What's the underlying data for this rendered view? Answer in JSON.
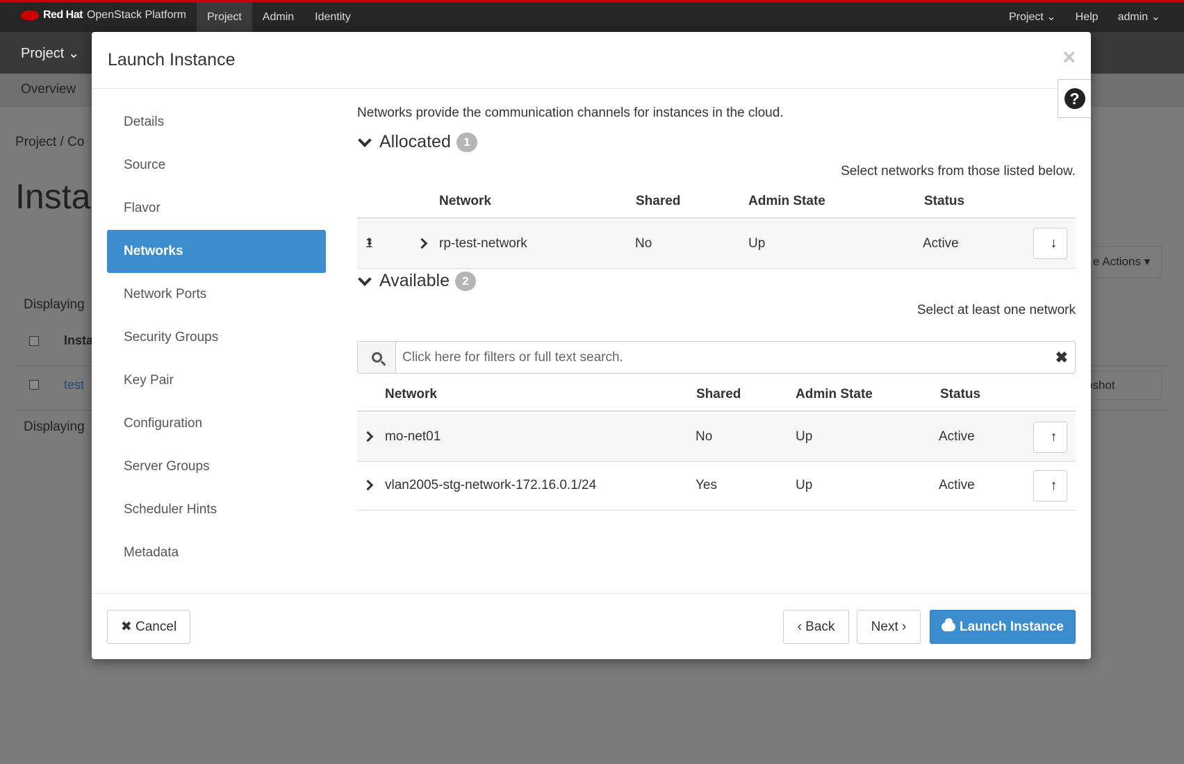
{
  "topbar": {
    "brand_bold": "Red Hat",
    "brand_rest": "OpenStack Platform",
    "nav": [
      "Project",
      "Admin",
      "Identity"
    ],
    "right": [
      "Project ⌄",
      "Help",
      "admin ⌄"
    ]
  },
  "background": {
    "project_menu": "Project ⌄",
    "overview_tab": "Overview",
    "breadcrumb": "Project / Co",
    "page_title": "Insta",
    "displaying_top": "Displaying",
    "displaying_bottom": "Displaying",
    "column_instance": "Insta",
    "row_instance": "test",
    "actions_button": "e Actions ▾",
    "snapshot_button": "pshot"
  },
  "modal": {
    "title": "Launch Instance",
    "close": "×",
    "help": "?",
    "nav": [
      {
        "label": "Details"
      },
      {
        "label": "Source"
      },
      {
        "label": "Flavor"
      },
      {
        "label": "Networks"
      },
      {
        "label": "Network Ports"
      },
      {
        "label": "Security Groups"
      },
      {
        "label": "Key Pair"
      },
      {
        "label": "Configuration"
      },
      {
        "label": "Server Groups"
      },
      {
        "label": "Scheduler Hints"
      },
      {
        "label": "Metadata"
      }
    ],
    "active_nav": "Networks",
    "intro": "Networks provide the communication channels for instances in the cloud.",
    "allocated": {
      "title": "Allocated",
      "count": "1",
      "hint": "Select networks from those listed below.",
      "columns": [
        "Network",
        "Shared",
        "Admin State",
        "Status"
      ],
      "rows": [
        {
          "order": "1",
          "network": "rp-test-network",
          "shared": "No",
          "admin_state": "Up",
          "status": "Active"
        }
      ]
    },
    "available": {
      "title": "Available",
      "count": "2",
      "hint": "Select at least one network",
      "search_placeholder": "Click here for filters or full text search.",
      "columns": [
        "Network",
        "Shared",
        "Admin State",
        "Status"
      ],
      "rows": [
        {
          "network": "mo-net01",
          "shared": "No",
          "admin_state": "Up",
          "status": "Active"
        },
        {
          "network": "vlan2005-stg-network-172.16.0.1/24",
          "shared": "Yes",
          "admin_state": "Up",
          "status": "Active"
        }
      ]
    },
    "footer": {
      "cancel": "Cancel",
      "back": "Back",
      "next": "Next",
      "launch": "Launch Instance"
    }
  },
  "colors": {
    "accent": "#3c8dce",
    "brand_red": "#cc0000"
  }
}
